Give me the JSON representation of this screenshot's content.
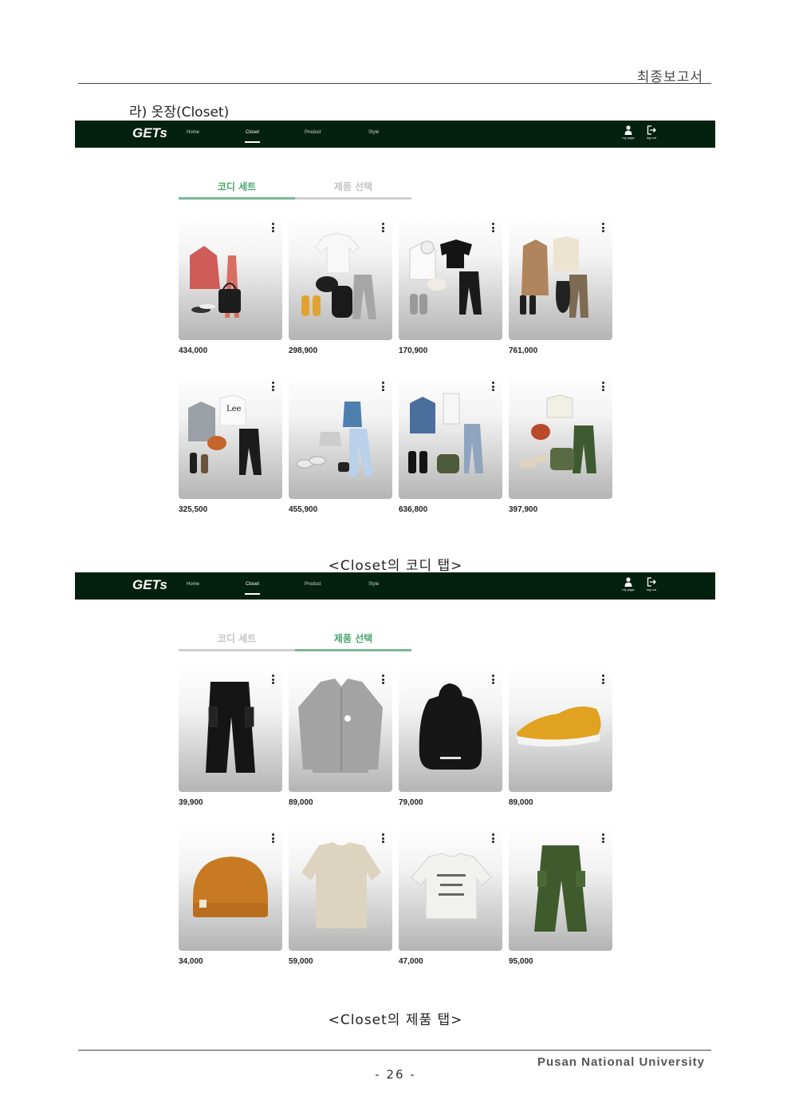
{
  "doc": {
    "header_title": "최종보고서",
    "section_title": "라) 옷장(Closet)",
    "footer_university": "Pusan National University",
    "footer_page": "- 26 -"
  },
  "app": {
    "logo": "GETs",
    "nav": [
      "Home",
      "Closet",
      "Product",
      "Style"
    ],
    "active_nav": "Closet",
    "my_page_label": "my page",
    "log_out_label": "log out",
    "tab_coordi": "코디 세트",
    "tab_product": "제품 선택",
    "brand_color": "#04200f",
    "accent_color": "#4aa56c"
  },
  "screen1": {
    "active_tab": "코디 세트",
    "prices": [
      "434,000",
      "298,900",
      "170,900",
      "761,000",
      "325,500",
      "455,900",
      "636,800",
      "397,900"
    ],
    "caption": "<Closet의 코디 탭>"
  },
  "screen2": {
    "active_tab": "제품 선택",
    "prices": [
      "39,900",
      "89,000",
      "79,000",
      "89,000",
      "34,000",
      "59,000",
      "47,000",
      "95,000"
    ],
    "caption": "<Closet의 제품 탭>"
  },
  "icons": [
    "more-vert-icon",
    "user-icon",
    "logout-icon"
  ]
}
